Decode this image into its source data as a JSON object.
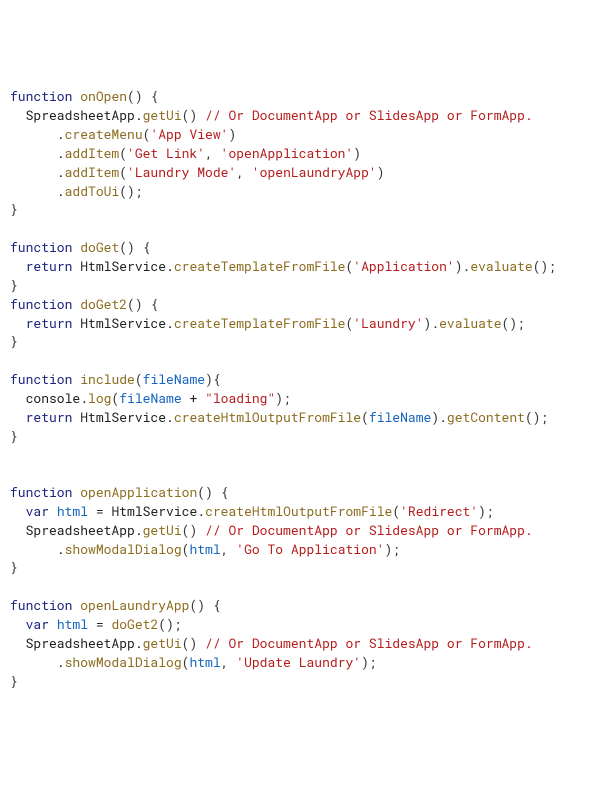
{
  "code": {
    "lines": [
      [
        [
          "kw",
          "function"
        ],
        [
          "plain",
          " "
        ],
        [
          "fn",
          "onOpen"
        ],
        [
          "pn",
          "() {"
        ]
      ],
      [
        [
          "plain",
          "  SpreadsheetApp."
        ],
        [
          "fn",
          "getUi"
        ],
        [
          "pn",
          "() "
        ],
        [
          "cmt",
          "// Or DocumentApp or SlidesApp or FormApp."
        ]
      ],
      [
        [
          "plain",
          "      ."
        ],
        [
          "fn",
          "createMenu"
        ],
        [
          "pn",
          "("
        ],
        [
          "str",
          "'App View'"
        ],
        [
          "pn",
          ")"
        ]
      ],
      [
        [
          "plain",
          "      ."
        ],
        [
          "fn",
          "addItem"
        ],
        [
          "pn",
          "("
        ],
        [
          "str",
          "'Get Link'"
        ],
        [
          "pn",
          ", "
        ],
        [
          "str",
          "'openApplication'"
        ],
        [
          "pn",
          ")"
        ]
      ],
      [
        [
          "plain",
          "      ."
        ],
        [
          "fn",
          "addItem"
        ],
        [
          "pn",
          "("
        ],
        [
          "str",
          "'Laundry Mode'"
        ],
        [
          "pn",
          ", "
        ],
        [
          "str",
          "'openLaundryApp'"
        ],
        [
          "pn",
          ")"
        ]
      ],
      [
        [
          "plain",
          "      ."
        ],
        [
          "fn",
          "addToUi"
        ],
        [
          "pn",
          "();"
        ]
      ],
      [
        [
          "pn",
          "}"
        ]
      ],
      [
        [
          "plain",
          ""
        ]
      ],
      [
        [
          "kw",
          "function"
        ],
        [
          "plain",
          " "
        ],
        [
          "fn",
          "doGet"
        ],
        [
          "pn",
          "() {"
        ]
      ],
      [
        [
          "plain",
          "  "
        ],
        [
          "kw",
          "return"
        ],
        [
          "plain",
          " HtmlService."
        ],
        [
          "fn",
          "createTemplateFromFile"
        ],
        [
          "pn",
          "("
        ],
        [
          "str",
          "'Application'"
        ],
        [
          "pn",
          "])."
        ],
        [
          "fn",
          "evaluate"
        ],
        [
          "pn",
          "();"
        ]
      ],
      [
        [
          "pn",
          "}"
        ]
      ],
      [
        [
          "kw",
          "function"
        ],
        [
          "plain",
          " "
        ],
        [
          "fn",
          "doGet2"
        ],
        [
          "pn",
          "() {"
        ]
      ],
      [
        [
          "plain",
          "  "
        ],
        [
          "kw",
          "return"
        ],
        [
          "plain",
          " HtmlService."
        ],
        [
          "fn",
          "createTemplateFromFile"
        ],
        [
          "pn",
          "("
        ],
        [
          "str",
          "'Laundry'"
        ],
        [
          "pn",
          "])."
        ],
        [
          "fn",
          "evaluate"
        ],
        [
          "pn",
          "();"
        ]
      ],
      [
        [
          "pn",
          "}"
        ]
      ],
      [
        [
          "plain",
          ""
        ]
      ],
      [
        [
          "kw",
          "function"
        ],
        [
          "plain",
          " "
        ],
        [
          "fn",
          "include"
        ],
        [
          "pn",
          "("
        ],
        [
          "param",
          "fileName"
        ],
        [
          "pn",
          "){"
        ]
      ],
      [
        [
          "plain",
          "  console."
        ],
        [
          "fn",
          "log"
        ],
        [
          "pn",
          "("
        ],
        [
          "param",
          "fileName"
        ],
        [
          "plain",
          " + "
        ],
        [
          "str",
          "\"loading\""
        ],
        [
          "pn",
          ");"
        ]
      ],
      [
        [
          "plain",
          "  "
        ],
        [
          "kw",
          "return"
        ],
        [
          "plain",
          " HtmlService."
        ],
        [
          "fn",
          "createHtmlOutputFromFile"
        ],
        [
          "pn",
          "("
        ],
        [
          "param",
          "fileName"
        ],
        [
          "pn",
          "])."
        ],
        [
          "fn",
          "getContent"
        ],
        [
          "pn",
          "();"
        ]
      ],
      [
        [
          "pn",
          "}"
        ]
      ],
      [
        [
          "plain",
          ""
        ]
      ],
      [
        [
          "plain",
          ""
        ]
      ],
      [
        [
          "kw",
          "function"
        ],
        [
          "plain",
          " "
        ],
        [
          "fn",
          "openApplication"
        ],
        [
          "pn",
          "() {"
        ]
      ],
      [
        [
          "plain",
          "  "
        ],
        [
          "kw",
          "var"
        ],
        [
          "plain",
          " "
        ],
        [
          "param",
          "html"
        ],
        [
          "plain",
          " = HtmlService."
        ],
        [
          "fn",
          "createHtmlOutputFromFile"
        ],
        [
          "pn",
          "("
        ],
        [
          "str",
          "'Redirect'"
        ],
        [
          "pn",
          ");"
        ]
      ],
      [
        [
          "plain",
          "  SpreadsheetApp."
        ],
        [
          "fn",
          "getUi"
        ],
        [
          "pn",
          "() "
        ],
        [
          "cmt",
          "// Or DocumentApp or SlidesApp or FormApp."
        ]
      ],
      [
        [
          "plain",
          "      ."
        ],
        [
          "fn",
          "showModalDialog"
        ],
        [
          "pn",
          "("
        ],
        [
          "param",
          "html"
        ],
        [
          "pn",
          ", "
        ],
        [
          "str",
          "'Go To Application'"
        ],
        [
          "pn",
          ");"
        ]
      ],
      [
        [
          "pn",
          "}"
        ]
      ],
      [
        [
          "plain",
          ""
        ]
      ],
      [
        [
          "kw",
          "function"
        ],
        [
          "plain",
          " "
        ],
        [
          "fn",
          "openLaundryApp"
        ],
        [
          "pn",
          "() {"
        ]
      ],
      [
        [
          "plain",
          "  "
        ],
        [
          "kw",
          "var"
        ],
        [
          "plain",
          " "
        ],
        [
          "param",
          "html"
        ],
        [
          "plain",
          " = "
        ],
        [
          "fn",
          "doGet2"
        ],
        [
          "pn",
          "();"
        ]
      ],
      [
        [
          "plain",
          "  SpreadsheetApp."
        ],
        [
          "fn",
          "getUi"
        ],
        [
          "pn",
          "() "
        ],
        [
          "cmt",
          "// Or DocumentApp or SlidesApp or FormApp."
        ]
      ],
      [
        [
          "plain",
          "      ."
        ],
        [
          "fn",
          "showModalDialog"
        ],
        [
          "pn",
          "("
        ],
        [
          "param",
          "html"
        ],
        [
          "pn",
          ", "
        ],
        [
          "str",
          "'Update Laundry'"
        ],
        [
          "pn",
          ");"
        ]
      ],
      [
        [
          "pn",
          "}"
        ]
      ]
    ]
  }
}
